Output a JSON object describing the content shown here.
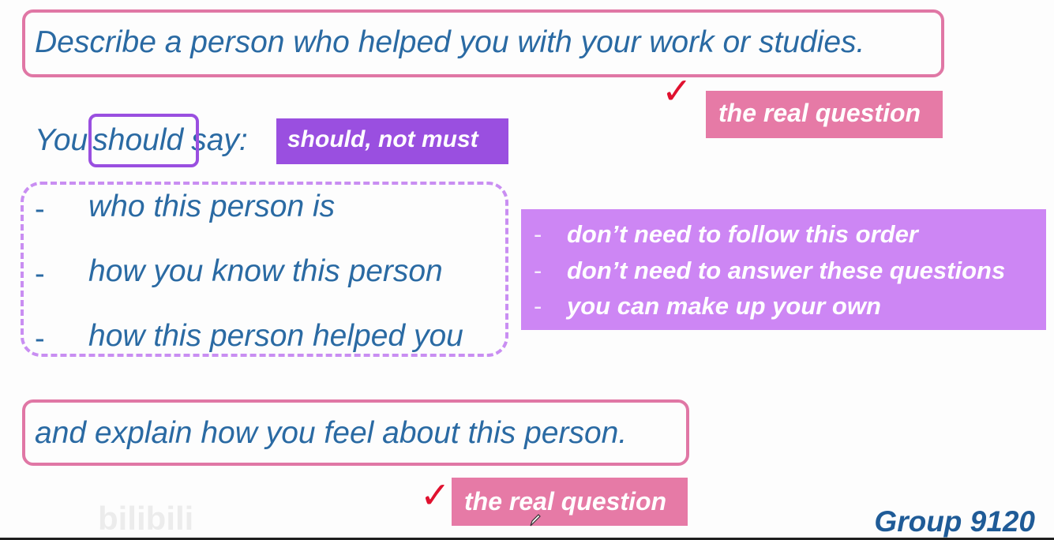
{
  "question": {
    "title": "Describe a person who helped you with your work or studies.",
    "real_question_tag": "the real question"
  },
  "prompt": {
    "you": "You",
    "should": "should",
    "say": "say:",
    "should_tag": "should, not must"
  },
  "bullets": [
    {
      "dash": "-",
      "text": "who this person is"
    },
    {
      "dash": "-",
      "text": "how you know this person"
    },
    {
      "dash": "-",
      "text": "how this person helped you"
    }
  ],
  "notes": [
    {
      "dash": "-",
      "text": "don’t need to follow this order"
    },
    {
      "dash": "-",
      "text": "don’t need to answer these questions"
    },
    {
      "dash": "-",
      "text": "you can make up your own"
    }
  ],
  "explain": {
    "text": "and explain how you feel about this person.",
    "real_question_tag": "the real question"
  },
  "footer": {
    "group_label": "Group 9120",
    "watermark": "bilibili"
  },
  "icons": {
    "check": "checkmark-icon",
    "cursor": "pen-cursor-icon"
  },
  "colors": {
    "question_text": "#2a6aa3",
    "pink_accent": "#e67aa6",
    "purple_accent": "#9a4fe0",
    "lilac_accent": "#cd86f4",
    "check_red": "#e0112f"
  }
}
